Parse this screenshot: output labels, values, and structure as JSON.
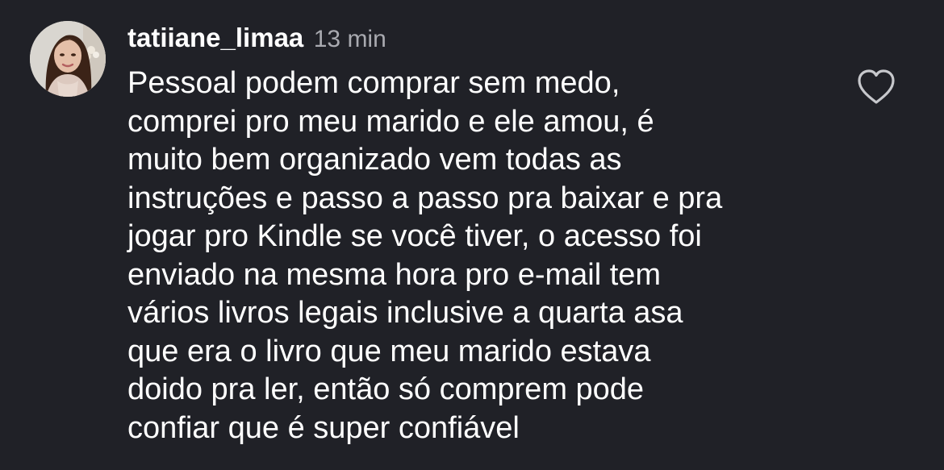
{
  "comment": {
    "username": "tatiiane_limaa",
    "time": "13 min",
    "body_lines": [
      "Pessoal podem comprar sem medo,",
      "comprei pro meu marido e ele amou, é",
      "muito bem organizado vem todas as",
      "instruções e passo a passo pra baixar e pra",
      "jogar pro Kindle se você tiver, o acesso foi",
      "enviado na mesma hora pro e-mail tem",
      "vários livros legais inclusive a quarta asa",
      "que era o livro que meu marido estava",
      "doido pra ler, então só comprem pode",
      "confiar que é super confiável"
    ],
    "like_icon": "heart-outline-icon"
  },
  "colors": {
    "background": "#202127",
    "text": "#ffffff",
    "muted": "#a9aab0",
    "icon": "#c7c8cc"
  }
}
